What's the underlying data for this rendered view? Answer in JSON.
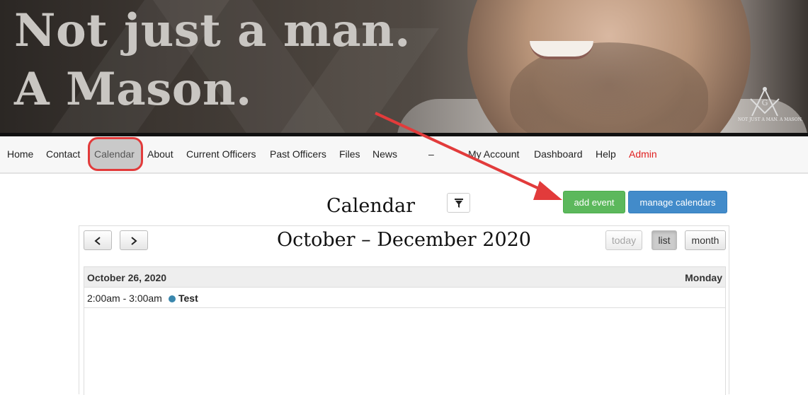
{
  "banner": {
    "headline_line1": "Not just a man.",
    "headline_line2": "A Mason.",
    "logo_tagline": "NOT JUST A MAN. A MASON.",
    "logo_letter": "G"
  },
  "nav": {
    "items": [
      "Home",
      "Contact",
      "Calendar",
      "About",
      "Current Officers",
      "Past Officers",
      "Files",
      "News",
      "–",
      "My Account",
      "Dashboard",
      "Help",
      "Admin"
    ],
    "active": "Calendar",
    "admin_color": "#e02020"
  },
  "page": {
    "title": "Calendar",
    "filter_icon": "filter-icon",
    "add_event_label": "add event",
    "manage_calendars_label": "manage calendars"
  },
  "calendar": {
    "range_title": "October – December 2020",
    "prev_icon": "chevron-left-icon",
    "next_icon": "chevron-right-icon",
    "views": {
      "today": "today",
      "list": "list",
      "month": "month"
    },
    "active_view": "list",
    "days": [
      {
        "date": "October 26, 2020",
        "weekday": "Monday",
        "events": [
          {
            "time": "2:00am - 3:00am",
            "title": "Test",
            "color": "#3a87ad"
          }
        ]
      }
    ]
  },
  "colors": {
    "add_event_bg": "#5cb85c",
    "manage_calendars_bg": "#428bca",
    "annotation_red": "#e23b3b"
  }
}
